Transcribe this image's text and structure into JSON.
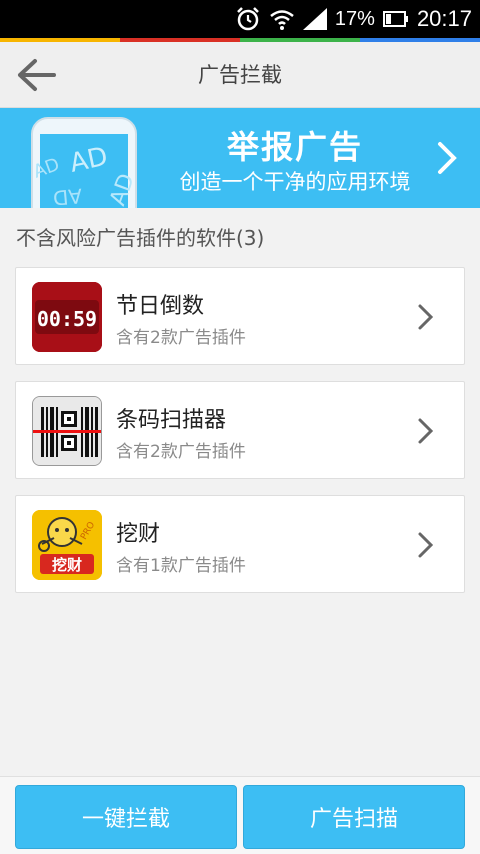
{
  "status_bar": {
    "battery_percent": "17%",
    "time": "20:17",
    "icons": [
      "alarm-icon",
      "wifi-icon",
      "signal-icon",
      "battery-icon"
    ]
  },
  "accent_colors": [
    "#f7b500",
    "#d93025",
    "#3cb34a",
    "#2f7fe8"
  ],
  "header": {
    "title": "广告拦截",
    "back_icon": "back-arrow-icon"
  },
  "banner": {
    "title": "举报广告",
    "subtitle": "创造一个干净的应用环境",
    "bg_color": "#3dbef3",
    "phone_text": [
      "AD",
      "AD",
      "AD",
      "AD"
    ]
  },
  "section_label": "不含风险广告插件的软件(3)",
  "apps": [
    {
      "name": "节日倒数",
      "desc": "含有2款广告插件",
      "icon_text": "00:59"
    },
    {
      "name": "条码扫描器",
      "desc": "含有2款广告插件",
      "icon_text": ""
    },
    {
      "name": "挖财",
      "desc": "含有1款广告插件",
      "icon_text": "挖财",
      "badge": "PRO"
    }
  ],
  "buttons": {
    "block_all": "一键拦截",
    "ad_scan": "广告扫描"
  }
}
